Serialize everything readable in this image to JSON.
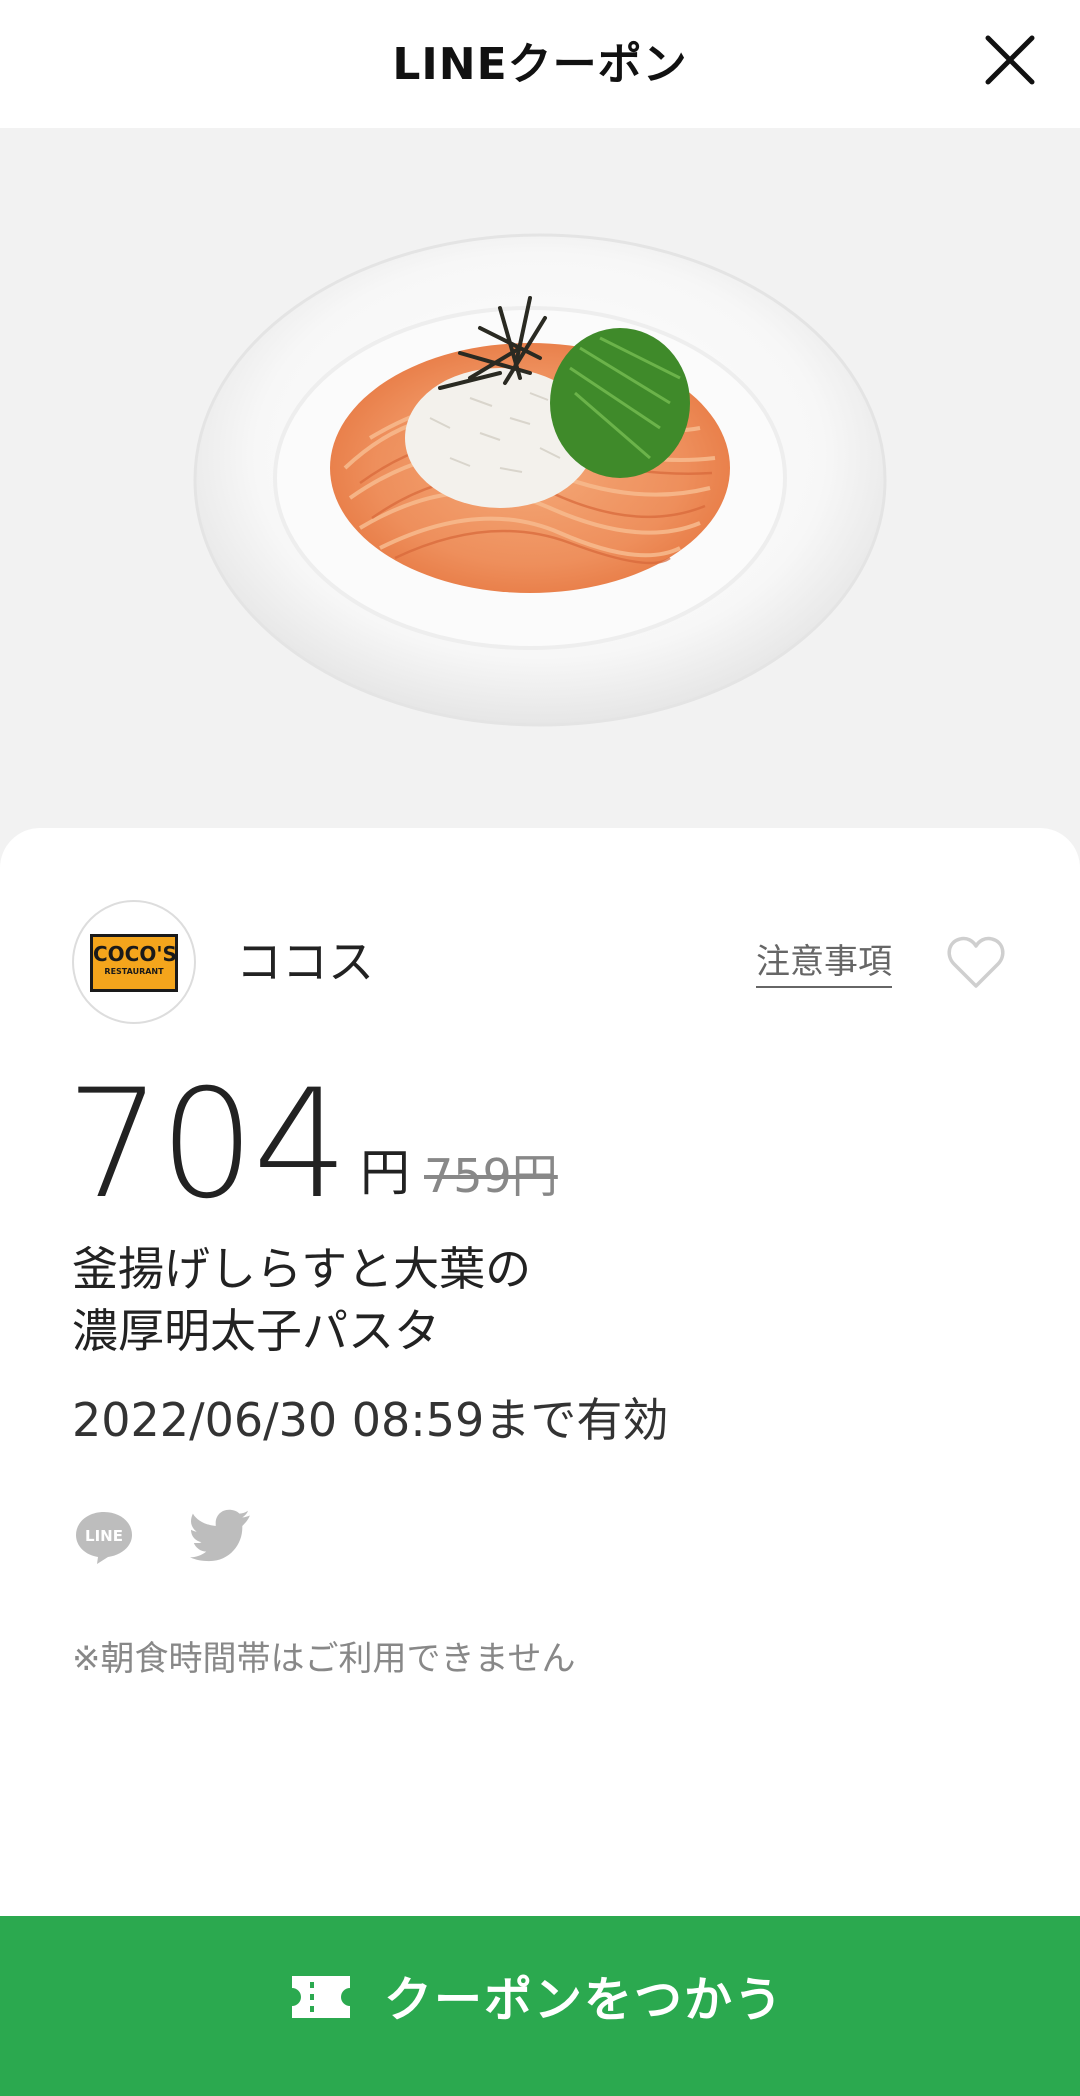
{
  "header": {
    "title": "LINEクーポン",
    "close_icon": "close-icon"
  },
  "hero": {
    "image": "pasta-dish-photo"
  },
  "store": {
    "logo_text": "COCO'S",
    "logo_subtext": "RESTAURANT",
    "name": "ココス",
    "notes_label": "注意事項",
    "favorite_icon": "heart-icon"
  },
  "coupon": {
    "price": "704",
    "price_unit": "円",
    "original_price": "759円",
    "item_name_lines": [
      "釜揚げしらすと大葉の",
      "濃厚明太子パスタ"
    ],
    "validity": "2022/06/30  08:59まで有効",
    "note": "※朝食時間帯はご利用できません"
  },
  "share": {
    "line_label": "LINE",
    "line_icon": "line-share-icon",
    "twitter_icon": "twitter-icon"
  },
  "cta": {
    "label": "クーポンをつかう",
    "icon": "ticket-icon"
  },
  "colors": {
    "cta_green": "#2ba94f",
    "hero_bg": "#f2f2f2",
    "logo_orange": "#f4a51c"
  }
}
